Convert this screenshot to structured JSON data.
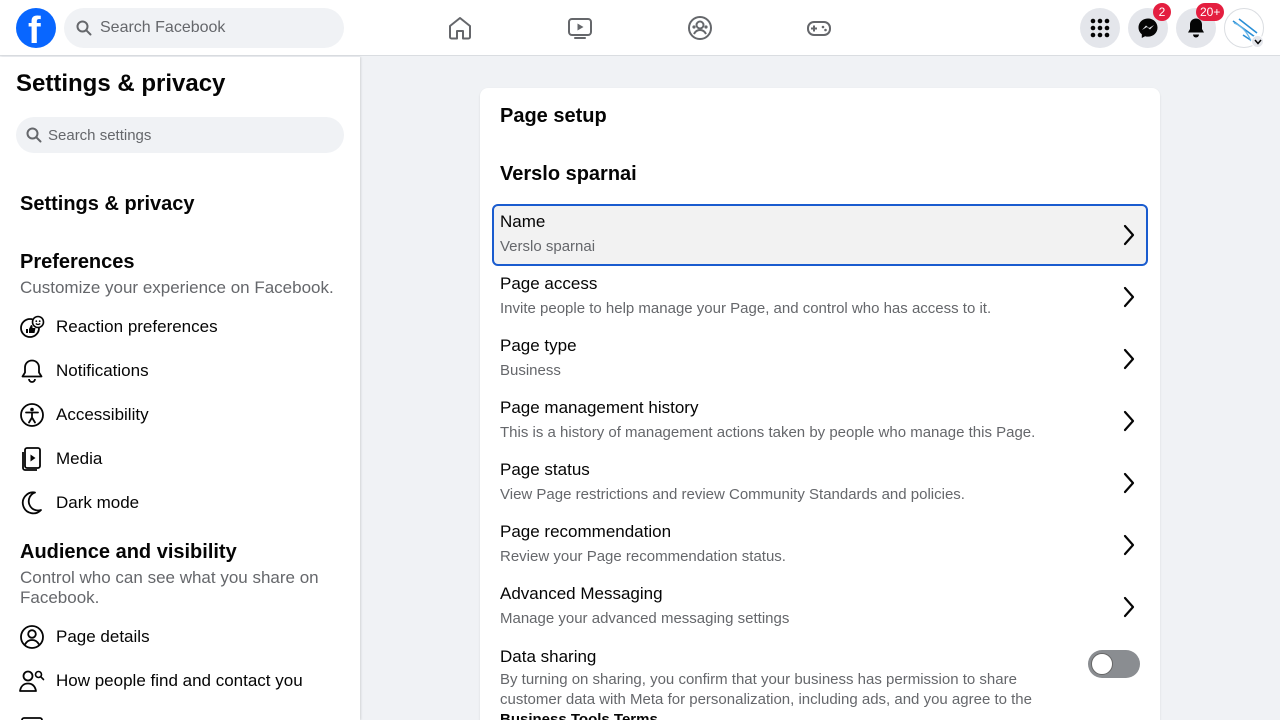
{
  "topbar": {
    "search_placeholder": "Search Facebook",
    "logo_text": "f",
    "messenger_badge": "2",
    "notifications_badge": "20+"
  },
  "sidebar": {
    "title": "Settings & privacy",
    "search_placeholder": "Search settings",
    "heading": "Settings & privacy",
    "preferences": {
      "title": "Preferences",
      "desc": "Customize your experience on Facebook.",
      "items": [
        {
          "label": "Reaction preferences",
          "icon": "reaction-icon"
        },
        {
          "label": "Notifications",
          "icon": "bell-icon"
        },
        {
          "label": "Accessibility",
          "icon": "accessibility-icon"
        },
        {
          "label": "Media",
          "icon": "media-icon"
        },
        {
          "label": "Dark mode",
          "icon": "moon-icon"
        }
      ]
    },
    "audience": {
      "title": "Audience and visibility",
      "desc": "Control who can see what you share on Facebook.",
      "items": [
        {
          "label": "Page details",
          "icon": "person-circle-icon"
        },
        {
          "label": "How people find and contact you",
          "icon": "people-search-icon"
        }
      ]
    }
  },
  "main": {
    "title": "Page setup",
    "page_name": "Verslo sparnai",
    "rows": [
      {
        "title": "Name",
        "desc": "Verslo sparnai"
      },
      {
        "title": "Page access",
        "desc": "Invite people to help manage your Page, and control who has access to it."
      },
      {
        "title": "Page type",
        "desc": "Business"
      },
      {
        "title": "Page management history",
        "desc": "This is a history of management actions taken by people who manage this Page."
      },
      {
        "title": "Page status",
        "desc": "View Page restrictions and review Community Standards and policies."
      },
      {
        "title": "Page recommendation",
        "desc": "Review your Page recommendation status."
      },
      {
        "title": "Advanced Messaging",
        "desc": "Manage your advanced messaging settings"
      }
    ],
    "data_sharing": {
      "title": "Data sharing",
      "desc": "By turning on sharing, you confirm that your business has permission to share customer data with Meta for personalization, including ads, and you agree to the",
      "link": "Business Tools Terms",
      "enabled": false
    }
  },
  "colors": {
    "brand": "#0866ff",
    "badge": "#e41e3f",
    "selected_border": "#1a5ccf"
  }
}
